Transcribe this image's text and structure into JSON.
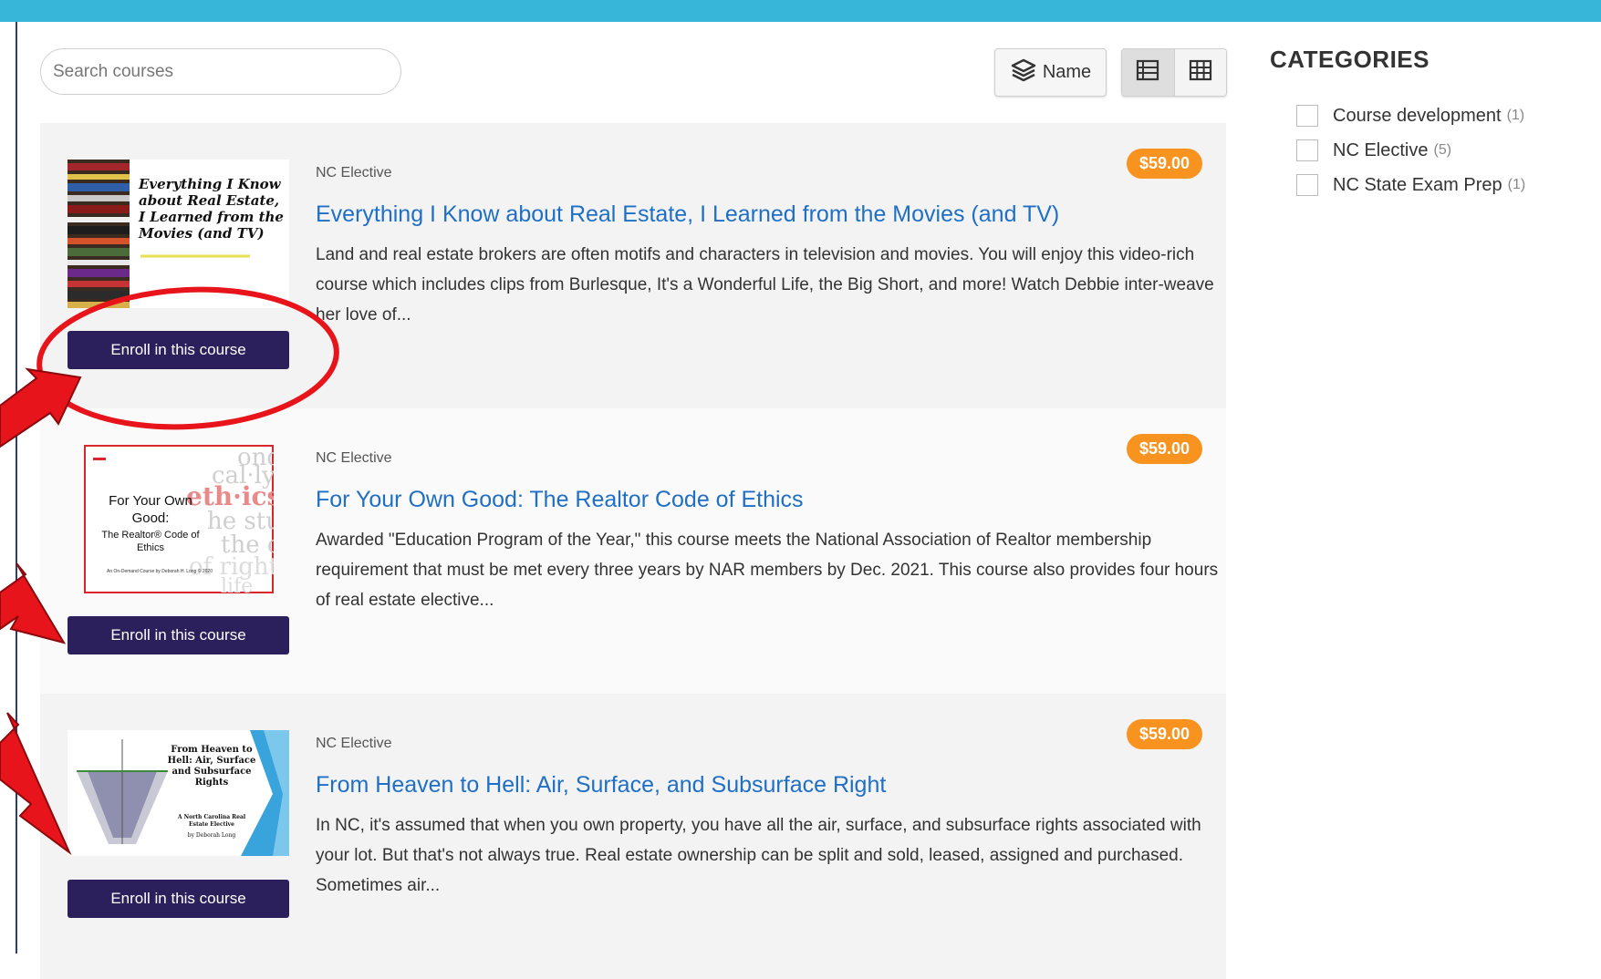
{
  "search": {
    "placeholder": "Search courses"
  },
  "toolbar": {
    "sort_label": "Name"
  },
  "courses": [
    {
      "category": "NC Elective",
      "price": "$59.00",
      "title": "Everything I Know about Real Estate, I Learned from the Movies (and TV)",
      "description": "Land and real estate brokers are often motifs and characters in television and movies. You will enjoy this video-rich course which includes clips from Burlesque, It's a Wonderful Life, the Big Short, and more! Watch Debbie inter-weave her love of...",
      "enroll_label": "Enroll in this course",
      "thumb_text": "Everything I Know about Real Estate, I Learned from the Movies (and TV)"
    },
    {
      "category": "NC Elective",
      "price": "$59.00",
      "title": "For Your Own Good: The Realtor Code of Ethics",
      "description": "Awarded \"Education Program of the Year,\" this course meets the National Association of Realtor membership requirement that must be met every three years by NAR members by Dec. 2021. This course also provides four hours of real estate elective...",
      "enroll_label": "Enroll in this course",
      "thumb_title": "For Your Own Good:",
      "thumb_sub": "The Realtor® Code of Ethics",
      "thumb_credit": "An On-Demand Course by Deborah H. Long © 2020"
    },
    {
      "category": "NC Elective",
      "price": "$59.00",
      "title": "From Heaven to Hell: Air, Surface, and Subsurface Right",
      "description": "In NC, it's assumed that when you own property, you have all the air, surface, and subsurface rights associated with your lot. But that's not always true. Real estate ownership can be split and sold, leased, assigned and purchased. Sometimes air...",
      "enroll_label": "Enroll in this course",
      "thumb_title": "From Heaven to Hell: Air, Surface and Subsurface Rights",
      "thumb_sub": "A North Carolina Real Estate Elective",
      "thumb_credit": "by Deborah Long"
    }
  ],
  "sidebar": {
    "heading": "CATEGORIES",
    "items": [
      {
        "label": "Course development",
        "count": "(1)"
      },
      {
        "label": "NC Elective",
        "count": "(5)"
      },
      {
        "label": "NC State Exam Prep",
        "count": "(1)"
      }
    ]
  },
  "colors": {
    "topbar": "#37b6d9",
    "link": "#1f6fc5",
    "price_badge": "#f7931e",
    "enroll_button": "#2b1f5c",
    "annotation": "#e8141b"
  }
}
